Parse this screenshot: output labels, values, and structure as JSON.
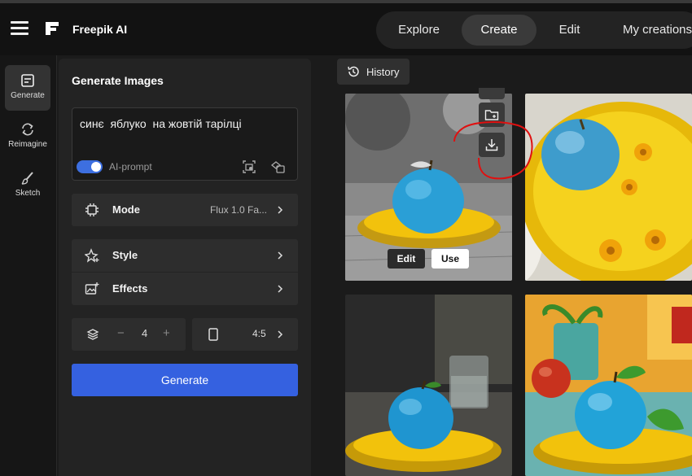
{
  "header": {
    "brand": "Freepik AI",
    "tabs": [
      {
        "label": "Explore",
        "active": false
      },
      {
        "label": "Create",
        "active": true
      },
      {
        "label": "Edit",
        "active": false
      },
      {
        "label": "My creations",
        "active": false
      }
    ]
  },
  "rail": {
    "items": [
      {
        "label": "Generate",
        "icon": "generate-icon",
        "active": true
      },
      {
        "label": "Reimagine",
        "icon": "reimagine-icon",
        "active": false
      },
      {
        "label": "Sketch",
        "icon": "brush-icon",
        "active": false
      }
    ]
  },
  "panel": {
    "title": "Generate Images",
    "prompt": "синє  яблуко  на жовтій тарілці",
    "ai_prompt_label": "AI-prompt",
    "ai_prompt_on": true,
    "mode": {
      "label": "Mode",
      "value": "Flux 1.0 Fa..."
    },
    "style": {
      "label": "Style"
    },
    "effects": {
      "label": "Effects"
    },
    "count": {
      "minus": "−",
      "value": "4",
      "plus": "+"
    },
    "ratio": {
      "value": "4:5"
    },
    "generate_label": "Generate"
  },
  "gallery": {
    "history_label": "History",
    "edit_label": "Edit",
    "use_label": "Use"
  },
  "colors": {
    "accent": "#3561e0",
    "annotation": "#e01010",
    "apple": "#2a9fd6",
    "plate": "#f2c20c"
  }
}
